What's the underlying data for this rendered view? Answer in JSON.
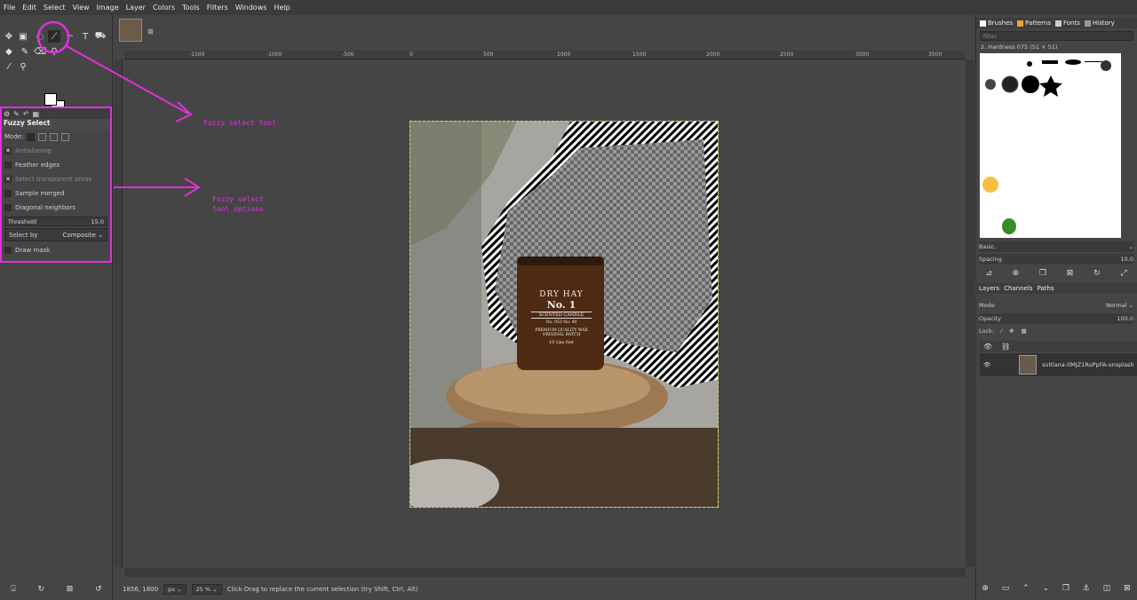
{
  "menubar": {
    "items": [
      "File",
      "Edit",
      "Select",
      "View",
      "Image",
      "Layer",
      "Colors",
      "Tools",
      "Filters",
      "Windows",
      "Help"
    ]
  },
  "tool_options": {
    "title": "Fuzzy Select",
    "mode_label": "Mode:",
    "antialiasing": "Antialiasing",
    "feather_edges": "Feather edges",
    "select_transparent": "Select transparent areas",
    "sample_merged": "Sample merged",
    "diagonal_neighbors": "Diagonal neighbors",
    "threshold_label": "Threshold",
    "threshold_value": "15.0",
    "select_by_label": "Select by",
    "select_by_value": "Composite",
    "draw_mask": "Draw mask"
  },
  "annotations": {
    "fuzzy_tool": "Fuzzy select tool",
    "options_line1": "Fuzzy select",
    "options_line2": "tool options"
  },
  "ruler": {
    "labels": [
      "-1500",
      "-1000",
      "-500",
      "0",
      "500",
      "1000",
      "1500",
      "2000",
      "2500",
      "3000",
      "3500"
    ]
  },
  "status": {
    "coords": "1856, 1800",
    "unit": "px",
    "zoom": "25 %",
    "message": "Click-Drag to replace the current selection (try Shift, Ctrl, Alt)"
  },
  "photo": {
    "line1": "DRY HAY",
    "line2": "No. 1",
    "line3": "SCENTED CANDLE",
    "line4": "No. 053      No. 40",
    "line5": "PREMIUM QUALITY WAX",
    "line6": "ORIGINAL BATCH",
    "line7": "10 Lbs.Net"
  },
  "dock": {
    "tabs": [
      "Brushes",
      "Patterns",
      "Fonts",
      "History"
    ],
    "filter_placeholder": "filter",
    "brush_name": "2. Hardness 075 (51 × 51)",
    "preset": "Basic,",
    "spacing_label": "Spacing",
    "spacing_value": "10.0",
    "layer_tabs": [
      "Layers",
      "Channels",
      "Paths"
    ],
    "mode_label": "Mode",
    "mode_value": "Normal",
    "opacity_label": "Opacity",
    "opacity_value": "100.0",
    "lock_label": "Lock:",
    "layer_name": "svitlana-0MJZ1RuPpFA-unsplash"
  }
}
